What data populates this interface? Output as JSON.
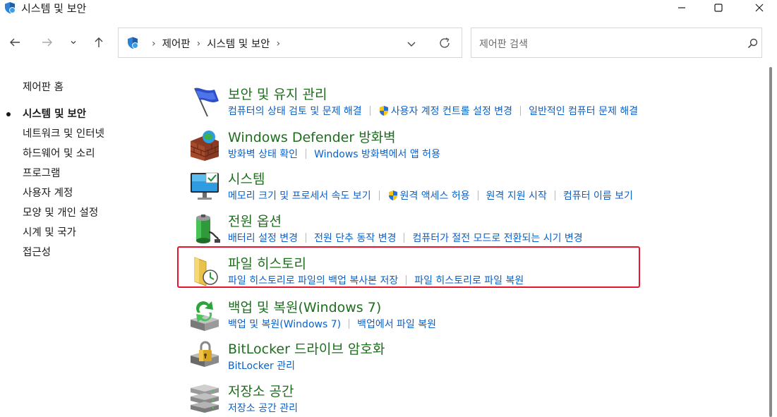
{
  "window": {
    "title": "시스템 및 보안"
  },
  "address": {
    "crumbs": [
      "제어판",
      "시스템 및 보안"
    ]
  },
  "search": {
    "placeholder": "제어판 검색"
  },
  "sidebar": {
    "home": "제어판 홈",
    "items": [
      {
        "label": "시스템 및 보안",
        "active": true
      },
      {
        "label": "네트워크 및 인터넷"
      },
      {
        "label": "하드웨어 및 소리"
      },
      {
        "label": "프로그램"
      },
      {
        "label": "사용자 계정"
      },
      {
        "label": "모양 및 개인 설정"
      },
      {
        "label": "시계 및 국가"
      },
      {
        "label": "접근성"
      }
    ]
  },
  "categories": [
    {
      "icon": "flag-icon",
      "title": "보안 및 유지 관리",
      "links": [
        {
          "label": "컴퓨터의 상태 검토 및 문제 해결"
        },
        {
          "label": "사용자 계정 컨트롤 설정 변경",
          "shield": true
        },
        {
          "label": "일반적인 컴퓨터 문제 해결"
        }
      ]
    },
    {
      "icon": "firewall-icon",
      "title": "Windows Defender 방화벽",
      "links": [
        {
          "label": "방화벽 상태 확인"
        },
        {
          "label": "Windows 방화벽에서 앱 허용"
        }
      ]
    },
    {
      "icon": "monitor-icon",
      "title": "시스템",
      "links": [
        {
          "label": "메모리 크기 및 프로세서 속도 보기"
        },
        {
          "label": "원격 액세스 허용",
          "shield": true
        },
        {
          "label": "원격 지원 시작"
        },
        {
          "label": "컴퓨터 이름 보기"
        }
      ]
    },
    {
      "icon": "battery-icon",
      "title": "전원 옵션",
      "links": [
        {
          "label": "배터리 설정 변경"
        },
        {
          "label": "전원 단추 동작 변경"
        },
        {
          "label": "컴퓨터가 절전 모드로 전환되는 시기 변경"
        }
      ]
    },
    {
      "icon": "file-history-icon",
      "title": "파일 히스토리",
      "links": [
        {
          "label": "파일 히스토리로 파일의 백업 복사본 저장"
        },
        {
          "label": "파일 히스토리로 파일 복원"
        }
      ]
    },
    {
      "icon": "backup-icon",
      "title": "백업 및 복원(Windows 7)",
      "links": [
        {
          "label": "백업 및 복원(Windows 7)"
        },
        {
          "label": "백업에서 파일 복원"
        }
      ]
    },
    {
      "icon": "bitlocker-icon",
      "title": "BitLocker 드라이브 암호화",
      "links": [
        {
          "label": "BitLocker 관리"
        }
      ]
    },
    {
      "icon": "storage-icon",
      "title": "저장소 공간",
      "links": [
        {
          "label": "저장소 공간 관리"
        }
      ]
    }
  ],
  "colors": {
    "title_green": "#1e6e1e",
    "link_blue": "#0a61c9",
    "highlight_red": "#e5162b"
  }
}
